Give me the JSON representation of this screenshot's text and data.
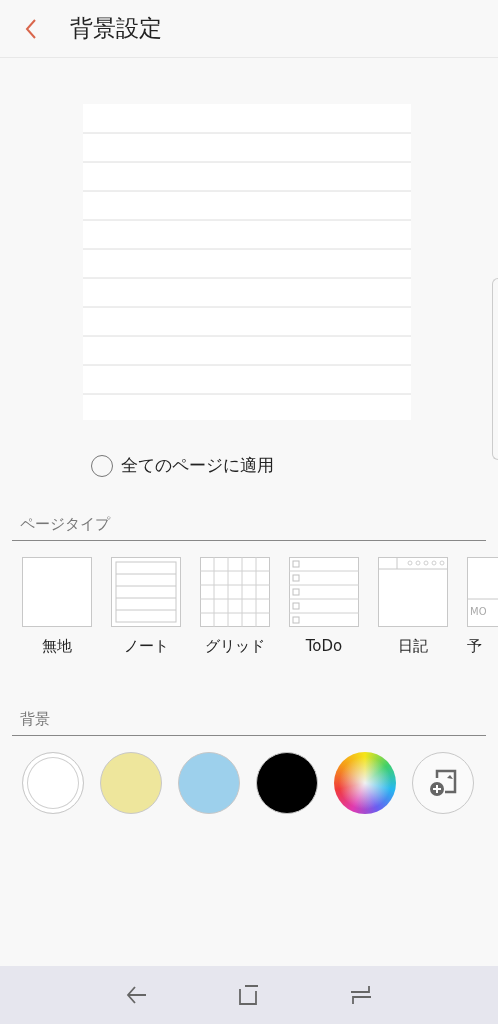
{
  "header": {
    "title": "背景設定"
  },
  "apply_all": {
    "label": "全てのページに適用",
    "checked": false
  },
  "page_type": {
    "heading": "ページタイプ",
    "items": [
      {
        "kind": "blank",
        "label": "無地"
      },
      {
        "kind": "note",
        "label": "ノート"
      },
      {
        "kind": "grid",
        "label": "グリッド"
      },
      {
        "kind": "todo",
        "label": "ToDo"
      },
      {
        "kind": "diary",
        "label": "日記"
      },
      {
        "kind": "schedule",
        "label": "予",
        "thumb_text": "MO"
      }
    ]
  },
  "background": {
    "heading": "背景",
    "swatches": [
      {
        "kind": "white",
        "color": "#ffffff"
      },
      {
        "kind": "color",
        "color": "#eee69c"
      },
      {
        "kind": "color",
        "color": "#9dd0ec"
      },
      {
        "kind": "color",
        "color": "#000000"
      },
      {
        "kind": "picker"
      },
      {
        "kind": "image"
      }
    ]
  }
}
